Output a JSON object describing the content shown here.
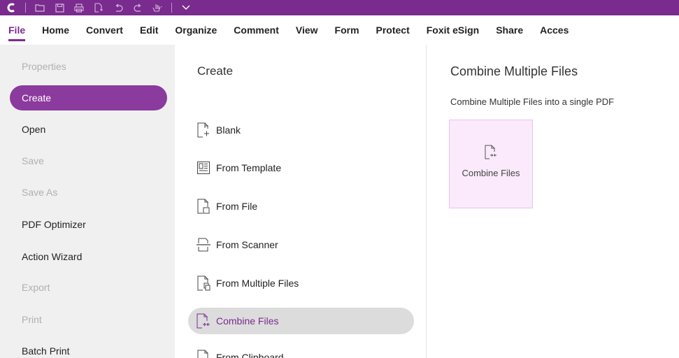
{
  "ribbon": {
    "tabs": [
      "File",
      "Home",
      "Convert",
      "Edit",
      "Organize",
      "Comment",
      "View",
      "Form",
      "Protect",
      "Foxit eSign",
      "Share",
      "Acces"
    ]
  },
  "nav": {
    "items": [
      "Properties",
      "Create",
      "Open",
      "Save",
      "Save As",
      "PDF Optimizer",
      "Action Wizard",
      "Export",
      "Print",
      "Batch Print"
    ]
  },
  "create": {
    "title": "Create",
    "options": [
      "Blank",
      "From Template",
      "From File",
      "From Scanner",
      "From Multiple Files",
      "Combine Files",
      "From Clipboard"
    ]
  },
  "detail": {
    "title": "Combine Multiple Files",
    "description": "Combine Multiple Files into a single PDF",
    "card_label": "Combine Files"
  },
  "colors": {
    "accent": "#7a2b8e",
    "nav_active": "#8b3a9e",
    "card_bg": "#faeafb"
  }
}
